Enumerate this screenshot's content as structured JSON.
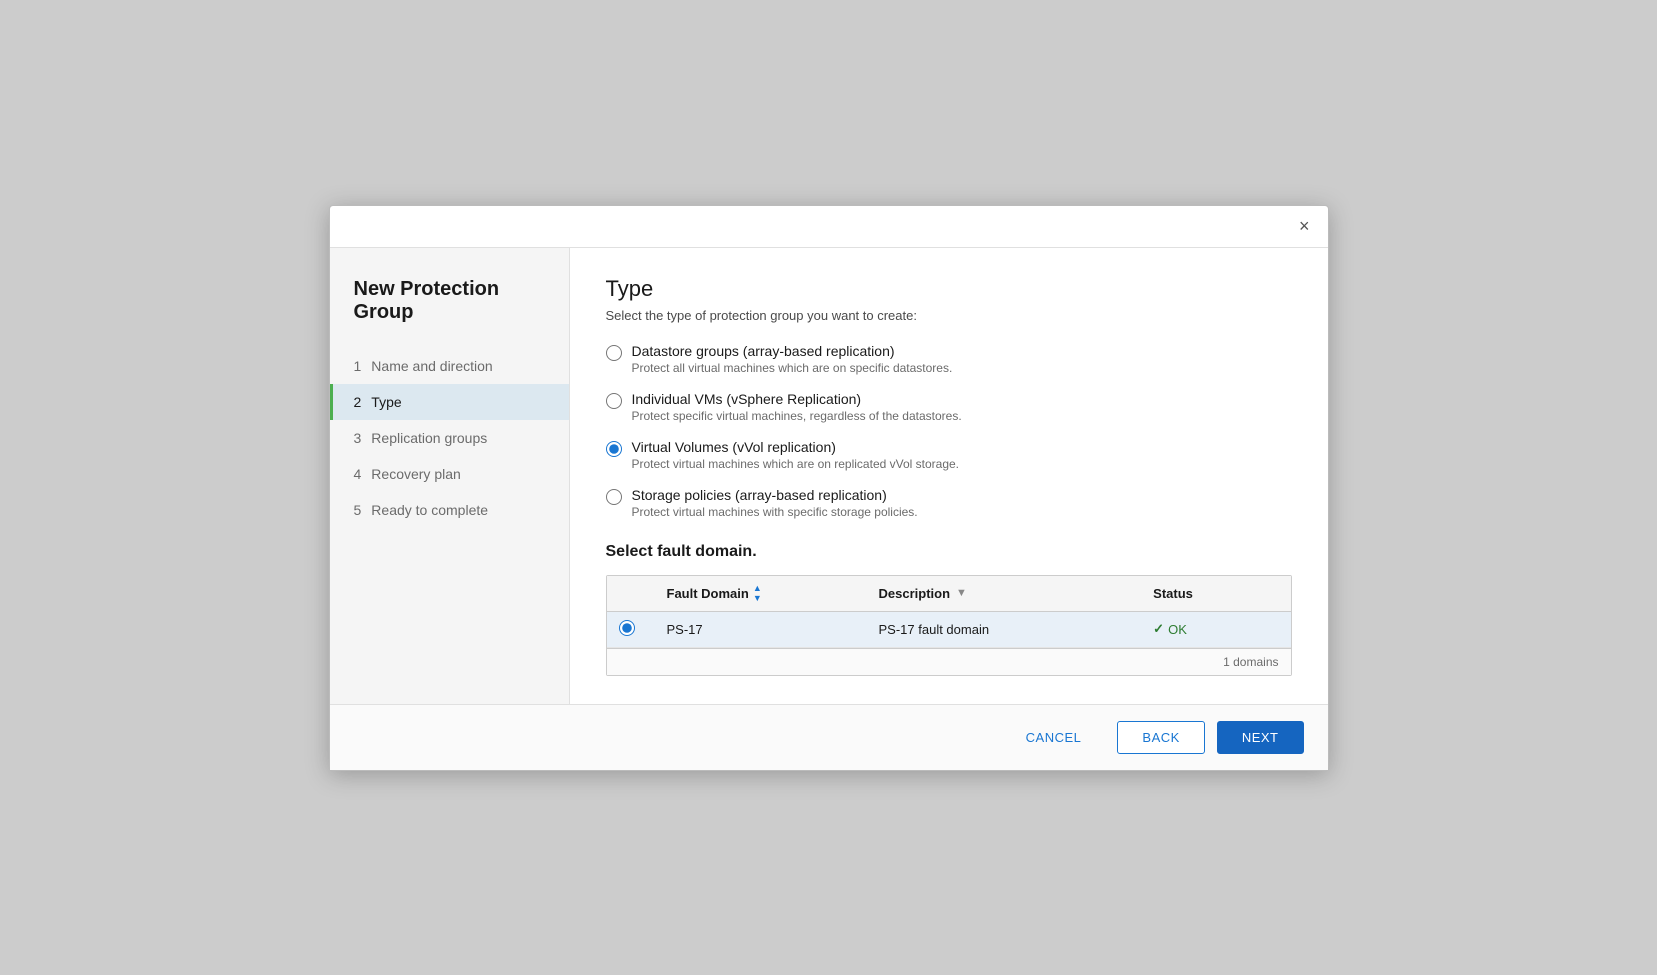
{
  "dialog": {
    "title": "New Protection Group",
    "close_label": "×"
  },
  "sidebar": {
    "items": [
      {
        "number": "1",
        "label": "Name and direction",
        "state": "completed"
      },
      {
        "number": "2",
        "label": "Type",
        "state": "active"
      },
      {
        "number": "3",
        "label": "Replication groups",
        "state": "inactive"
      },
      {
        "number": "4",
        "label": "Recovery plan",
        "state": "inactive"
      },
      {
        "number": "5",
        "label": "Ready to complete",
        "state": "inactive"
      }
    ]
  },
  "main": {
    "section_title": "Type",
    "section_subtitle": "Select the type of protection group you want to create:",
    "radio_options": [
      {
        "id": "opt-datastore",
        "label": "Datastore groups (array-based replication)",
        "desc": "Protect all virtual machines which are on specific datastores.",
        "checked": false
      },
      {
        "id": "opt-individual",
        "label": "Individual VMs (vSphere Replication)",
        "desc": "Protect specific virtual machines, regardless of the datastores.",
        "checked": false
      },
      {
        "id": "opt-vvol",
        "label": "Virtual Volumes (vVol replication)",
        "desc": "Protect virtual machines which are on replicated vVol storage.",
        "checked": true
      },
      {
        "id": "opt-storage",
        "label": "Storage policies (array-based replication)",
        "desc": "Protect virtual machines with specific storage policies.",
        "checked": false
      }
    ],
    "fault_domain": {
      "title": "Select fault domain.",
      "table": {
        "columns": [
          {
            "key": "radio",
            "label": ""
          },
          {
            "key": "fault_domain",
            "label": "Fault Domain",
            "sortable": true,
            "filterable": false
          },
          {
            "key": "description",
            "label": "Description",
            "sortable": false,
            "filterable": true
          },
          {
            "key": "status",
            "label": "Status",
            "sortable": false,
            "filterable": false
          }
        ],
        "rows": [
          {
            "selected": true,
            "fault_domain": "PS-17",
            "description": "PS-17 fault domain",
            "status": "OK"
          }
        ],
        "footer": "1 domains"
      }
    }
  },
  "footer": {
    "cancel_label": "CANCEL",
    "back_label": "BACK",
    "next_label": "NEXT"
  }
}
